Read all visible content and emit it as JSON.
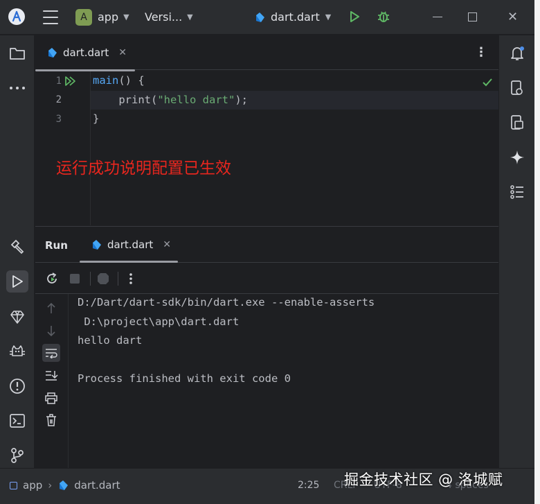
{
  "titlebar": {
    "project_badge": "A",
    "project_name": "app",
    "vcs_label": "Versi...",
    "run_config": "dart.dart"
  },
  "editor": {
    "tab_label": "dart.dart",
    "line_numbers": [
      "1",
      "2",
      "3"
    ],
    "code": {
      "line1_fn": "main",
      "line1_rest": "() {",
      "line2_indent": "    ",
      "line2_fn": "print",
      "line2_open": "(",
      "line2_str": "\"hello dart\"",
      "line2_close": ");",
      "line3": "}"
    },
    "annotation": "运行成功说明配置已生效"
  },
  "run_panel": {
    "title": "Run",
    "tab_label": "dart.dart",
    "console": [
      "D:/Dart/dart-sdk/bin/dart.exe --enable-asserts",
      " D:\\project\\app\\dart.dart",
      "hello dart",
      "",
      "Process finished with exit code 0"
    ]
  },
  "statusbar": {
    "crumb_project": "app",
    "crumb_file": "dart.dart",
    "cursor": "2:25",
    "line_sep": "CRLF",
    "encoding": "UTF-8",
    "indent": "4 spaces"
  },
  "watermark": "掘金技术社区 @ 洛城赋",
  "colors": {
    "background": "#1e1f22",
    "panel": "#2b2d30",
    "run_green": "#5fb865",
    "function_blue": "#56a8f5",
    "string_green": "#6aab73",
    "annotation_red": "#e8261e",
    "dart_blue": "#42a5f5"
  }
}
